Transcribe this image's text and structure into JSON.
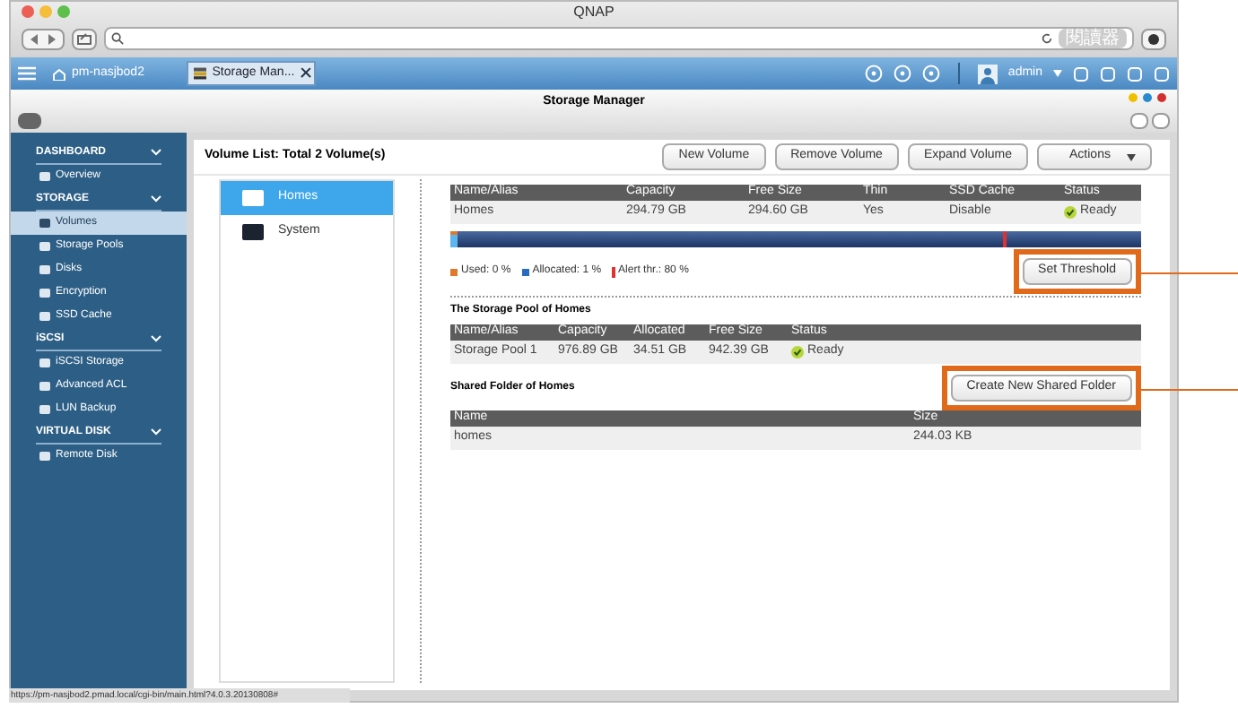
{
  "window": {
    "title": "QNAP",
    "reader_button": "閱讀器"
  },
  "app_tabs": [
    {
      "label": "pm-nasjbod2",
      "selected": false,
      "kind": "home"
    },
    {
      "label": "Storage Man...",
      "selected": true,
      "kind": "app"
    }
  ],
  "user": {
    "name": "admin"
  },
  "app_title": "Storage Manager",
  "sidebar": [
    {
      "label": "DASHBOARD",
      "children": [
        {
          "label": "Overview",
          "selected": false
        }
      ]
    },
    {
      "label": "STORAGE",
      "children": [
        {
          "label": "Volumes",
          "selected": true
        },
        {
          "label": "Storage Pools",
          "selected": false
        },
        {
          "label": "Disks",
          "selected": false
        },
        {
          "label": "Encryption",
          "selected": false
        },
        {
          "label": "SSD Cache",
          "selected": false
        }
      ]
    },
    {
      "label": "iSCSI",
      "children": [
        {
          "label": "iSCSI Storage",
          "selected": false
        },
        {
          "label": "Advanced ACL",
          "selected": false
        },
        {
          "label": "LUN Backup",
          "selected": false
        }
      ]
    },
    {
      "label": "VIRTUAL DISK",
      "children": [
        {
          "label": "Remote Disk",
          "selected": false
        }
      ]
    }
  ],
  "volume_list": {
    "title": "Volume List: Total 2 Volume(s)",
    "items": [
      {
        "label": "Homes",
        "selected": true
      },
      {
        "label": "System",
        "selected": false
      }
    ]
  },
  "toolbar": [
    "New Volume",
    "Remove Volume",
    "Expand Volume",
    "Actions"
  ],
  "volume_table": {
    "columns": [
      "Name/Alias",
      "Capacity",
      "Free Size",
      "Thin",
      "SSD Cache",
      "Status"
    ],
    "rows": [
      [
        "Homes",
        "294.79 GB",
        "294.60 GB",
        "Yes",
        "Disable",
        "Ready"
      ]
    ]
  },
  "usage": {
    "used": {
      "level": 0.01
    },
    "allocated": {
      "level": 0.01
    },
    "alert": {
      "level": 0.8
    },
    "legend": [
      "Used: 0 %",
      "Allocated: 1 %",
      "Alert thr.: 80 %"
    ]
  },
  "threshold_button": {
    "label": "Set Threshold",
    "highlighted": true
  },
  "pool": {
    "title": "The Storage Pool of Homes",
    "columns": [
      "Name/Alias",
      "Capacity",
      "Allocated",
      "Free Size",
      "Status"
    ],
    "rows": [
      [
        "Storage Pool 1",
        "976.89 GB",
        "34.51 GB",
        "942.39 GB",
        "Ready"
      ]
    ]
  },
  "shared": {
    "title": "Shared Folder of Homes",
    "button": {
      "label": "Create New Shared Folder",
      "highlighted": true
    },
    "columns": [
      "Name",
      "Size"
    ],
    "rows": [
      [
        "homes",
        "244.03 KB"
      ]
    ]
  },
  "status_url": "https://pm-nasjbod2.pmad.local/cgi-bin/main.html?4.0.3.20130808#"
}
